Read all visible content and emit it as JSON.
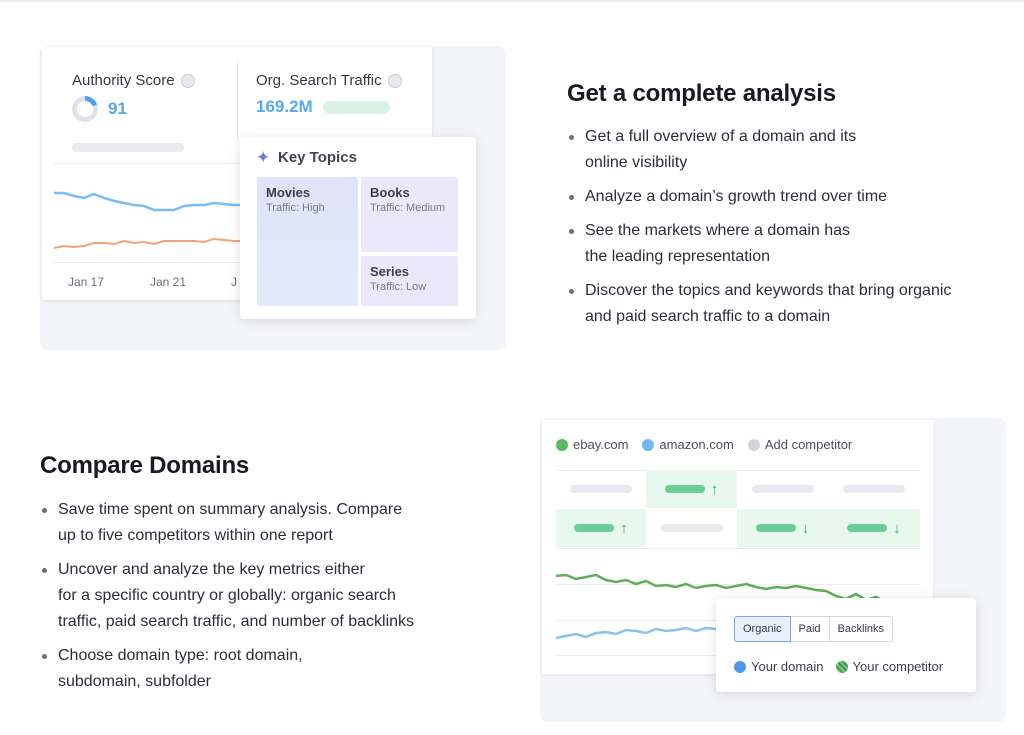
{
  "analysis": {
    "authority": {
      "label": "Authority Score",
      "value": "91"
    },
    "traffic": {
      "label": "Org. Search Traffic",
      "value": "169.2M"
    },
    "x_labels": [
      "Jan 17",
      "Jan 21",
      "J"
    ],
    "key_topics": {
      "title": "Key Topics",
      "tiles": [
        {
          "name": "Movies",
          "traffic": "Traffic: High"
        },
        {
          "name": "Books",
          "traffic": "Traffic: Medium"
        },
        {
          "name": "Series",
          "traffic": "Traffic: Low"
        }
      ]
    },
    "heading": "Get a complete analysis",
    "bullets": [
      [
        "Get a full overview of a domain and its",
        "online visibility"
      ],
      [
        "Analyze a domain’s growth trend over time"
      ],
      [
        "See the markets where a domain has",
        "the leading representation"
      ],
      [
        "Discover the topics and keywords that bring organic",
        "and paid search traffic to a domain"
      ]
    ]
  },
  "compare": {
    "heading": "Compare Domains",
    "bullets": [
      [
        "Save time spent on summary analysis. Compare",
        "up to five competitors within one report"
      ],
      [
        "Uncover and analyze the key metrics either",
        "for a specific country or globally: organic search",
        "traffic, paid search traffic, and number of backlinks"
      ],
      [
        "Choose domain type: root domain,",
        "subdomain, subfolder"
      ]
    ],
    "domains": [
      {
        "label": "ebay.com",
        "color": "#5cb85c"
      },
      {
        "label": "amazon.com",
        "color": "#74b8f0"
      },
      {
        "label": "Add competitor",
        "color": "#d3d5da"
      }
    ],
    "tabs": [
      "Organic",
      "Paid",
      "Backlinks"
    ],
    "active_tab": "Organic",
    "legend": [
      {
        "label": "Your domain",
        "color": "#4f98ec"
      },
      {
        "label": "Your competitor",
        "color": "#3f9a4e"
      }
    ]
  },
  "colors": {
    "accent_blue": "#55a8f0",
    "accent_green": "#6ccf99",
    "line_orange": "#f2a477"
  }
}
